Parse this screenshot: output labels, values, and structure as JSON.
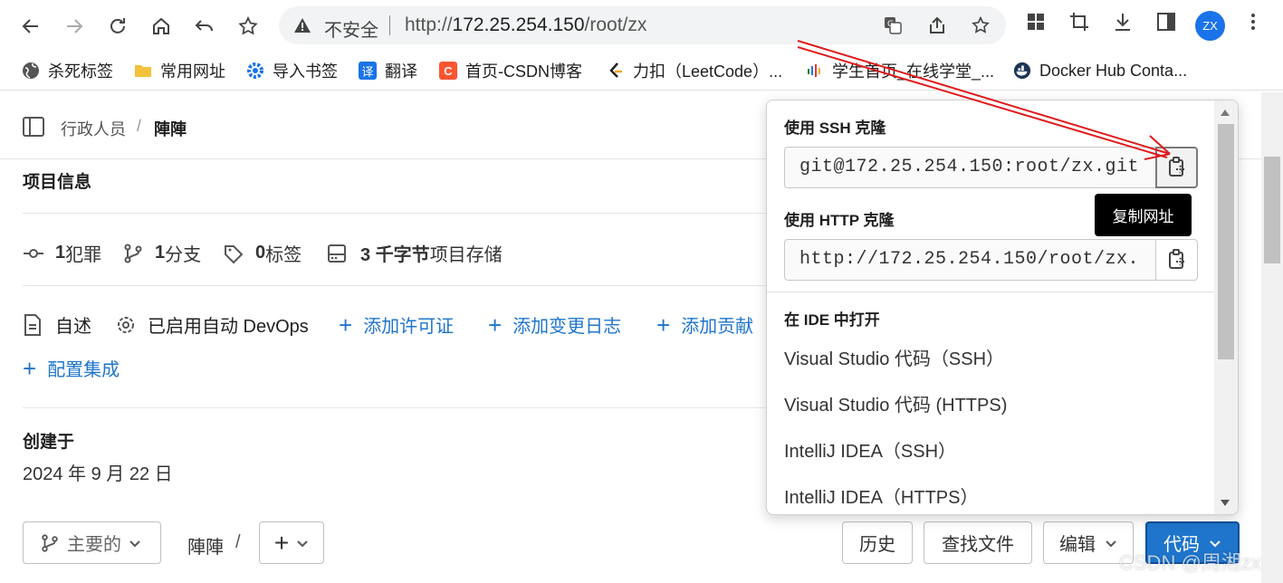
{
  "browser": {
    "security_text": "不安全",
    "url_prefix": "http://",
    "url_host": "172.25.254.150",
    "url_path": "/root/zx",
    "avatar_initials": "ZX"
  },
  "bookmarks": [
    {
      "label": "杀死标签",
      "icon": "globe-icon"
    },
    {
      "label": "常用网址",
      "icon": "folder-icon"
    },
    {
      "label": "导入书签",
      "icon": "gear-icon"
    },
    {
      "label": "翻译",
      "icon": "translate-icon",
      "glyph": "译"
    },
    {
      "label": "首页-CSDN博客",
      "icon": "csdn-icon",
      "glyph": "C"
    },
    {
      "label": "力扣（LeetCode）...",
      "icon": "leetcode-icon"
    },
    {
      "label": "学生首页_在线学堂_...",
      "icon": "xuetang-icon"
    },
    {
      "label": "Docker Hub Conta...",
      "icon": "docker-icon"
    }
  ],
  "breadcrumb": {
    "parent": "行政人员",
    "separator": "/",
    "current": "陣陣"
  },
  "project_info": {
    "title": "项目信息",
    "stats": [
      {
        "value": "1",
        "label": "犯罪"
      },
      {
        "value": "1",
        "label": "分支"
      },
      {
        "value": "0",
        "label": "标签"
      },
      {
        "value": "3 千字节",
        "label": "项目存储"
      }
    ],
    "readme": "自述",
    "devops": "已启用自动 DevOps",
    "add_license": "添加许可证",
    "add_changelog": "添加变更日志",
    "add_contributing": "添加贡献",
    "configure_integrations": "配置集成"
  },
  "created": {
    "title": "创建于",
    "date": "2024 年 9 月 22 日"
  },
  "repo_bar": {
    "branch": "主要的",
    "path": "陣陣",
    "path_sep": "/",
    "add_label": "+",
    "history": "历史",
    "find_file": "查找文件",
    "edit": "编辑",
    "code": "代码"
  },
  "clone_dropdown": {
    "ssh_label": "使用 SSH 克隆",
    "ssh_url": "git@172.25.254.150:root/zx.git",
    "http_label": "使用 HTTP 克隆",
    "http_url": "http://172.25.254.150/root/zx.",
    "ide_label": "在 IDE 中打开",
    "ide_items": [
      "Visual Studio 代码（SSH）",
      "Visual Studio 代码 (HTTPS)",
      "IntelliJ IDEA（SSH）",
      "IntelliJ IDEA（HTTPS）"
    ],
    "tooltip": "复制网址"
  },
  "watermark": "CSDN @周湘zx",
  "colors": {
    "link_blue": "#1f75cb",
    "annotation_red": "#e0191b",
    "tooltip_bg": "#000000"
  }
}
